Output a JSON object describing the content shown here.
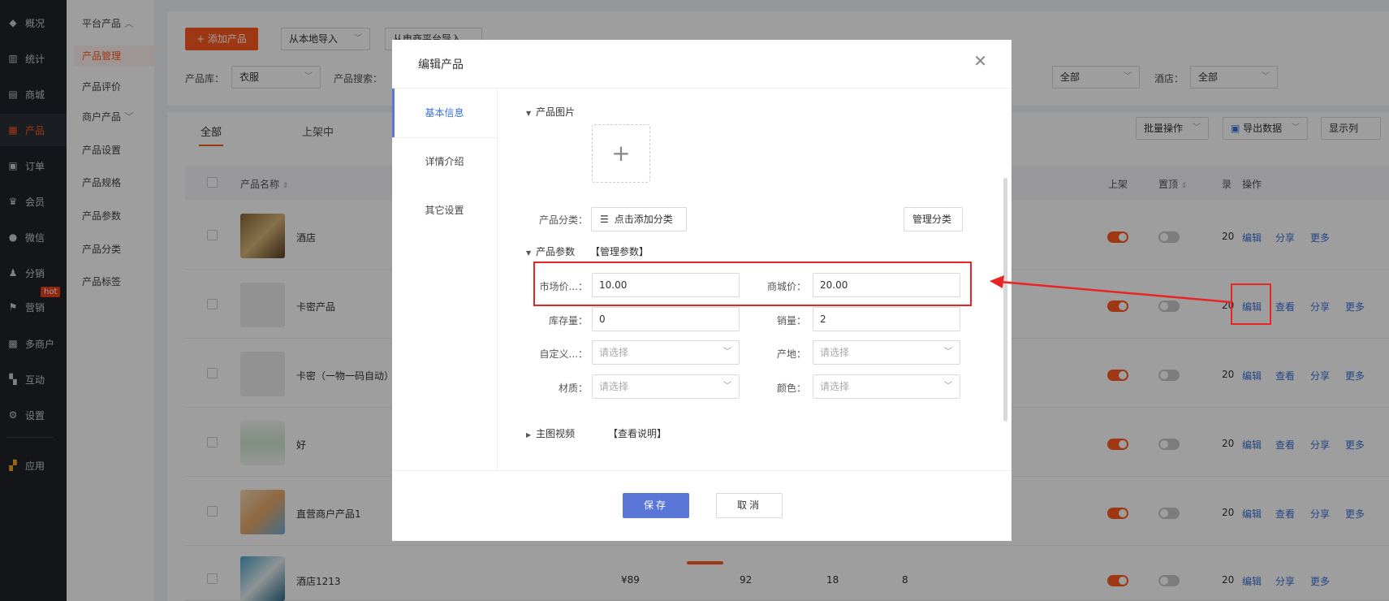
{
  "sidebar": {
    "items": [
      {
        "label": "概况",
        "icon": "layers-icon"
      },
      {
        "label": "统计",
        "icon": "chart-icon"
      },
      {
        "label": "商城",
        "icon": "store-icon"
      },
      {
        "label": "产品",
        "icon": "grid-icon"
      },
      {
        "label": "订单",
        "icon": "order-icon"
      },
      {
        "label": "会员",
        "icon": "crown-icon"
      },
      {
        "label": "微信",
        "icon": "wechat-icon"
      },
      {
        "label": "分销",
        "icon": "users-icon"
      },
      {
        "label": "营销",
        "icon": "flag-icon"
      },
      {
        "label": "多商户",
        "icon": "shop-icon"
      },
      {
        "label": "互动",
        "icon": "apps-icon"
      },
      {
        "label": "设置",
        "icon": "gear-icon"
      },
      {
        "label": "应用",
        "icon": "app-grid-icon"
      }
    ],
    "hot": "hot",
    "active": "产品",
    "accent": "#ff5a1f"
  },
  "subnav": {
    "group1": "平台产品",
    "items": [
      "产品管理",
      "产品评价"
    ],
    "group2": "商户产品",
    "items2": [
      "产品设置",
      "产品规格",
      "产品参数",
      "产品分类",
      "产品标签"
    ]
  },
  "toolbar": {
    "add": "+ 添加产品",
    "import_local": "从本地导入",
    "import_platform": "从电商平台导入"
  },
  "filters": {
    "lib_label": "产品库：",
    "lib_value": "衣服",
    "search_label": "产品搜索：",
    "all1": "全部",
    "hotel_label": "酒店：",
    "all2": "全部"
  },
  "tabs": {
    "all": "全部",
    "on": "上架中"
  },
  "actions": {
    "batch": "批量操作",
    "export": "导出数据",
    "columns": "显示列"
  },
  "table": {
    "headers": {
      "name": "产品名称",
      "on": "上架",
      "top": "置顶",
      "rec": "录",
      "ops": "操作"
    },
    "rows": [
      {
        "name": "酒店",
        "ops": [
          "编辑",
          "分享",
          "更多"
        ]
      },
      {
        "name": "卡密产品",
        "ops": [
          "编辑",
          "查看",
          "分享",
          "更多"
        ]
      },
      {
        "name": "卡密（一物一码自动）",
        "ops": [
          "编辑",
          "查看",
          "分享",
          "更多"
        ]
      },
      {
        "name": "好",
        "ops": [
          "编辑",
          "查看",
          "分享",
          "更多"
        ]
      },
      {
        "name": "直营商户产品1",
        "ops": [
          "编辑",
          "查看",
          "分享",
          "更多"
        ]
      },
      {
        "name": "酒店1213",
        "price": "¥89",
        "c1": "92",
        "c2": "18",
        "c3": "8",
        "ops": [
          "编辑",
          "分享",
          "更多"
        ]
      }
    ],
    "rec_col": "20"
  },
  "modal": {
    "title": "编辑产品",
    "nav": [
      "基本信息",
      "详情介绍",
      "其它设置"
    ],
    "sec_image": "产品图片",
    "cat_label": "产品分类：",
    "cat_btn": "点击添加分类",
    "manage_cat": "管理分类",
    "sec_params": "产品参数",
    "manage_params": "【管理参数】",
    "fields": {
      "market_label": "市场价...：",
      "market_value": "10.00",
      "mall_label": "商城价：",
      "mall_value": "20.00",
      "stock_label": "库存量：",
      "stock_value": "0",
      "sales_label": "销量：",
      "sales_value": "2",
      "custom_label": "自定义...：",
      "origin_label": "产地：",
      "material_label": "材质：",
      "color_label": "颜色：",
      "placeholder": "请选择"
    },
    "sec_video": "主图视频",
    "video_help": "【查看说明】",
    "save": "保存",
    "cancel": "取消"
  }
}
